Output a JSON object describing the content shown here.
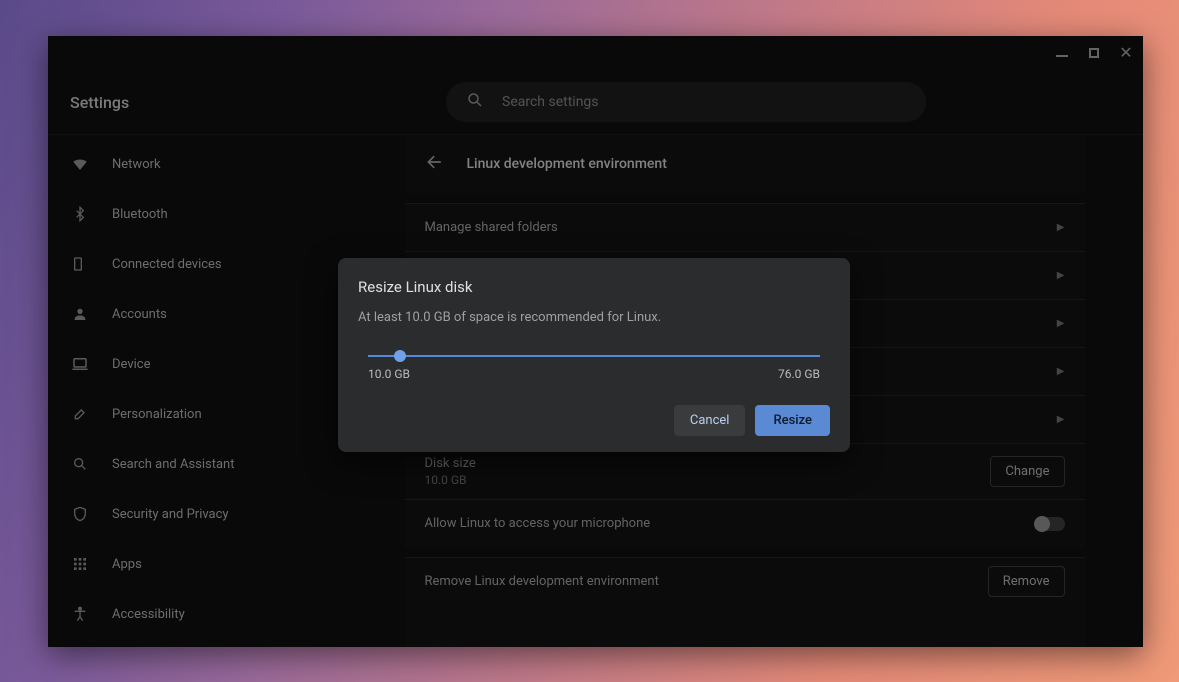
{
  "app_title": "Settings",
  "search": {
    "placeholder": "Search settings"
  },
  "sidebar": {
    "items": [
      {
        "label": "Network",
        "icon": "wifi-icon"
      },
      {
        "label": "Bluetooth",
        "icon": "bluetooth-icon"
      },
      {
        "label": "Connected devices",
        "icon": "devices-icon"
      },
      {
        "label": "Accounts",
        "icon": "person-icon"
      },
      {
        "label": "Device",
        "icon": "laptop-icon"
      },
      {
        "label": "Personalization",
        "icon": "brush-icon"
      },
      {
        "label": "Search and Assistant",
        "icon": "search-icon"
      },
      {
        "label": "Security and Privacy",
        "icon": "shield-icon"
      },
      {
        "label": "Apps",
        "icon": "apps-icon"
      },
      {
        "label": "Accessibility",
        "icon": "accessibility-icon"
      }
    ]
  },
  "panel": {
    "title": "Linux development environment",
    "rows": {
      "manage_shared": "Manage shared folders",
      "disk_size_label": "Disk size",
      "disk_size_value": "10.0 GB",
      "change_btn": "Change",
      "mic_label": "Allow Linux to access your microphone",
      "remove_label": "Remove Linux development environment",
      "remove_btn": "Remove"
    }
  },
  "dialog": {
    "title": "Resize Linux disk",
    "subtitle": "At least 10.0 GB of space is recommended for Linux.",
    "min_label": "10.0 GB",
    "max_label": "76.0 GB",
    "cancel": "Cancel",
    "confirm": "Resize"
  }
}
